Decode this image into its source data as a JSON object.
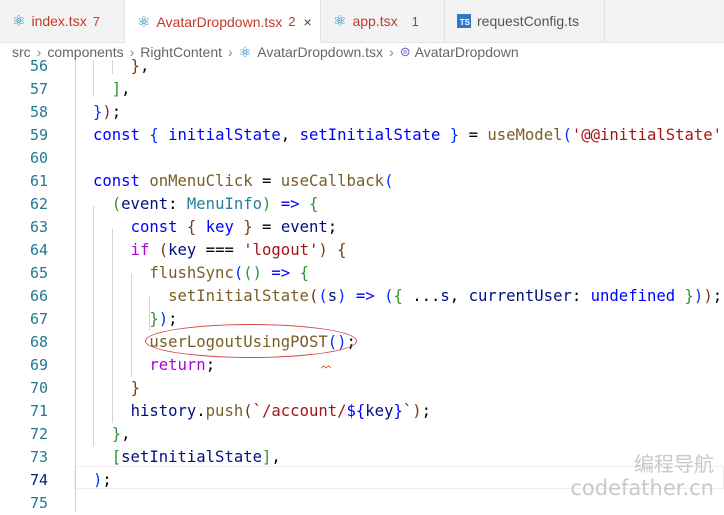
{
  "tabs": [
    {
      "name": "index.tsx",
      "badge": "7",
      "icon": "react-icon"
    },
    {
      "name": "AvatarDropdown.tsx",
      "badge": "2",
      "icon": "react-icon",
      "active": true
    },
    {
      "name": "app.tsx",
      "badge": "1",
      "icon": "react-icon"
    },
    {
      "name": "requestConfig.ts",
      "badge": "",
      "icon": "typescript-icon"
    }
  ],
  "tab_close_glyph": "×",
  "breadcrumb": {
    "items": [
      "src",
      "components",
      "RightContent",
      "AvatarDropdown.tsx",
      "AvatarDropdown"
    ]
  },
  "lines": [
    {
      "n": "56"
    },
    {
      "n": "57"
    },
    {
      "n": "58"
    },
    {
      "n": "59"
    },
    {
      "n": "60"
    },
    {
      "n": "61"
    },
    {
      "n": "62"
    },
    {
      "n": "63"
    },
    {
      "n": "64"
    },
    {
      "n": "65"
    },
    {
      "n": "66"
    },
    {
      "n": "67"
    },
    {
      "n": "68"
    },
    {
      "n": "69"
    },
    {
      "n": "70"
    },
    {
      "n": "71"
    },
    {
      "n": "72"
    },
    {
      "n": "73"
    },
    {
      "n": "74"
    },
    {
      "n": "75"
    }
  ],
  "current_line": "74",
  "watermark": {
    "line1": "编程导航",
    "line2": "codefather.cn"
  },
  "colors": {
    "keyword": "#0000ff",
    "function": "#795e26",
    "string": "#a31515",
    "annotation_ring": "#d64545"
  }
}
